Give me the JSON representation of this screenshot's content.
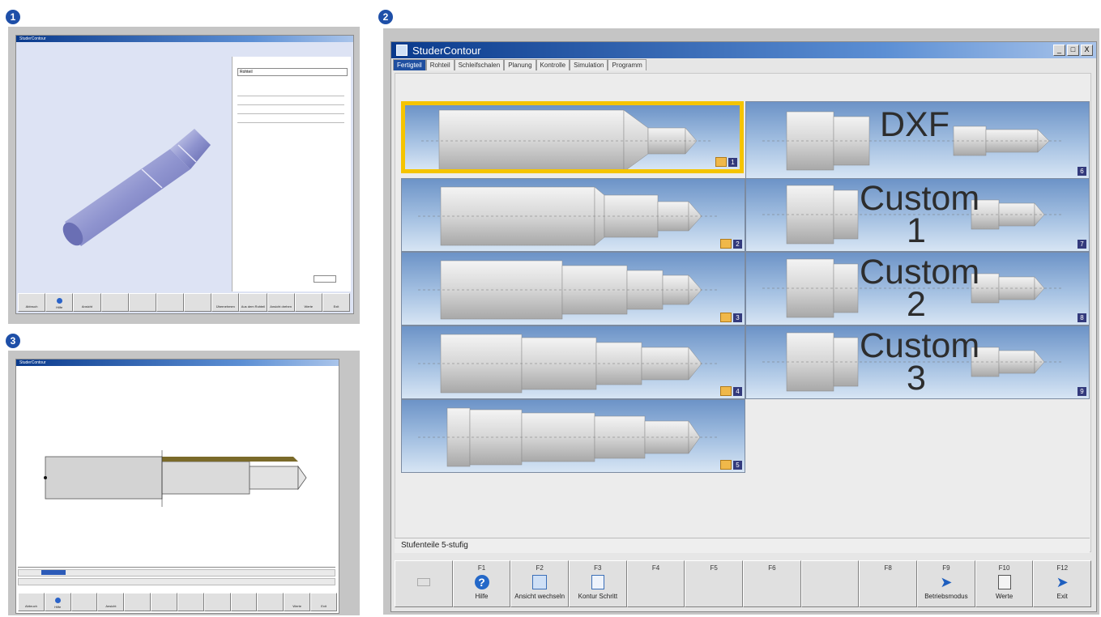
{
  "badges": [
    "1",
    "2",
    "3"
  ],
  "main": {
    "title": "StuderContour",
    "window_controls": [
      "_",
      "□",
      "X"
    ],
    "tabs": [
      "Fertigteil",
      "Rohteil",
      "Schleifschalen",
      "Planung",
      "Kontrolle",
      "Simulation",
      "Programm"
    ],
    "active_tab": 0,
    "tiles_left": [
      {
        "num": "1"
      },
      {
        "num": "2"
      },
      {
        "num": "3"
      },
      {
        "num": "4"
      },
      {
        "num": "5"
      }
    ],
    "tiles_right": [
      {
        "num": "6",
        "label_line1": "DXF",
        "label_line2": ""
      },
      {
        "num": "7",
        "label_line1": "Custom",
        "label_line2": "1"
      },
      {
        "num": "8",
        "label_line1": "Custom",
        "label_line2": "2"
      },
      {
        "num": "9",
        "label_line1": "Custom",
        "label_line2": "3"
      }
    ],
    "status_text": "Stufenteile 5-stufig",
    "fkeys": [
      {
        "code": "",
        "label": "",
        "icon": "blank",
        "disabled": true
      },
      {
        "code": "F1",
        "label": "Hilfe",
        "icon": "help-icon",
        "disabled": false
      },
      {
        "code": "F2",
        "label": "Ansicht wechseln",
        "icon": "view-icon",
        "disabled": false
      },
      {
        "code": "F3",
        "label": "Kontur Schritt",
        "icon": "contour-icon",
        "disabled": false
      },
      {
        "code": "F4",
        "label": "",
        "icon": "blank",
        "disabled": true
      },
      {
        "code": "F5",
        "label": "",
        "icon": "blank",
        "disabled": true
      },
      {
        "code": "F6",
        "label": "",
        "icon": "blank",
        "disabled": true
      },
      {
        "code": "",
        "label": "",
        "icon": "blank",
        "disabled": true
      },
      {
        "code": "F8",
        "label": "",
        "icon": "blank",
        "disabled": true
      },
      {
        "code": "F9",
        "label": "Betriebsmodus",
        "icon": "arrow-right-icon",
        "disabled": false
      },
      {
        "code": "F10",
        "label": "Werte",
        "icon": "values-icon",
        "disabled": false
      },
      {
        "code": "F12",
        "label": "Exit",
        "icon": "exit-icon",
        "disabled": false
      }
    ]
  },
  "win1": {
    "title": "StuderContour",
    "dropdown_value": "Rohteil",
    "fkeys": [
      "Abbruch",
      "Hilfe",
      "Ansicht",
      "",
      "",
      "",
      "",
      "Übernehmen",
      "Aus dem Rohteil",
      "Ansicht drehen",
      "Werte",
      "Exit"
    ]
  },
  "win3": {
    "title": "StuderContour",
    "fkeys": [
      "Abbruch",
      "Hilfe",
      "",
      "Ansicht",
      "",
      "",
      "",
      "",
      "",
      "",
      "Werte",
      "Exit"
    ]
  }
}
